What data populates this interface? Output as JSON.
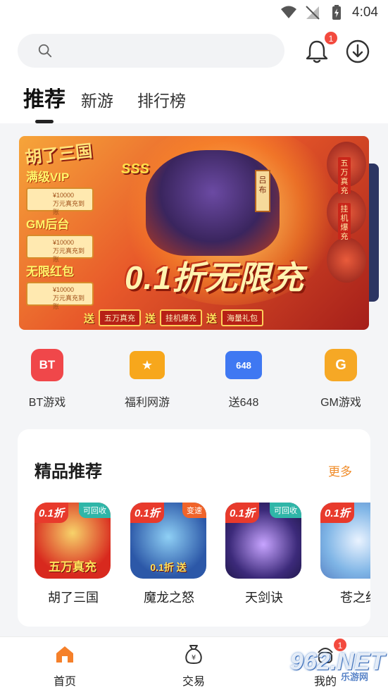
{
  "status_bar": {
    "time": "4:04"
  },
  "search": {
    "placeholder": ""
  },
  "notifications": {
    "badge_count": "1"
  },
  "tabs": [
    {
      "label": "推荐",
      "active": true
    },
    {
      "label": "新游",
      "active": false
    },
    {
      "label": "排行榜",
      "active": false
    }
  ],
  "banner": {
    "logo": "胡了三国",
    "vip_title": "满级VIP",
    "gm_title": "GM后台",
    "red_packet_title": "无限红包",
    "card_text_amount": "¥10000",
    "card_text_desc": "万元真充到账",
    "rank_badge": "SSS",
    "hero_name": "吕布",
    "side_tag_1": "五万真充",
    "side_tag_2": "挂机爆充",
    "slogan": "0.1折无限充",
    "send_label": "送",
    "perks": [
      "五万真充",
      "挂机爆充",
      "海量礼包"
    ]
  },
  "categories": [
    {
      "label": "BT游戏",
      "icon": "bt-icon",
      "icon_text": "BT",
      "color": "#f0474a"
    },
    {
      "label": "福利网游",
      "icon": "welfare-monitor-icon",
      "icon_text": "★",
      "color": "#f7a71c"
    },
    {
      "label": "送648",
      "icon": "648-icon",
      "icon_text": "648",
      "color": "#3f78f2"
    },
    {
      "label": "GM游戏",
      "icon": "gm-icon",
      "icon_text": "G",
      "color": "#f6a825"
    }
  ],
  "featured": {
    "title": "精品推荐",
    "more_label": "更多",
    "games": [
      {
        "name": "胡了三国",
        "discount": "0.1折",
        "tag": "可回收",
        "tag_color": "#2fb6a8",
        "icon_text": "五万真充",
        "bg": "#d8291e"
      },
      {
        "name": "魔龙之怒",
        "discount": "0.1折",
        "tag": "变速",
        "tag_color": "#f0642a",
        "icon_text": "0.1折 送",
        "bg": "#2c58a8"
      },
      {
        "name": "天剑诀",
        "discount": "0.1折",
        "tag": "可回收",
        "tag_color": "#2fb6a8",
        "icon_text": "",
        "bg": "#3c2a7a"
      },
      {
        "name": "苍之纪",
        "discount": "0.1折",
        "tag": "",
        "tag_color": "#2fb6a8",
        "icon_text": "",
        "bg": "#7fb5e6"
      }
    ]
  },
  "bottom_nav": [
    {
      "label": "首页",
      "icon": "home-icon",
      "active": true
    },
    {
      "label": "交易",
      "icon": "money-bag-icon",
      "active": false
    },
    {
      "label": "我的",
      "icon": "profile-icon",
      "active": false
    }
  ],
  "profile_badge": "1",
  "watermark": {
    "text": "962.NET",
    "sub": "乐游网"
  }
}
